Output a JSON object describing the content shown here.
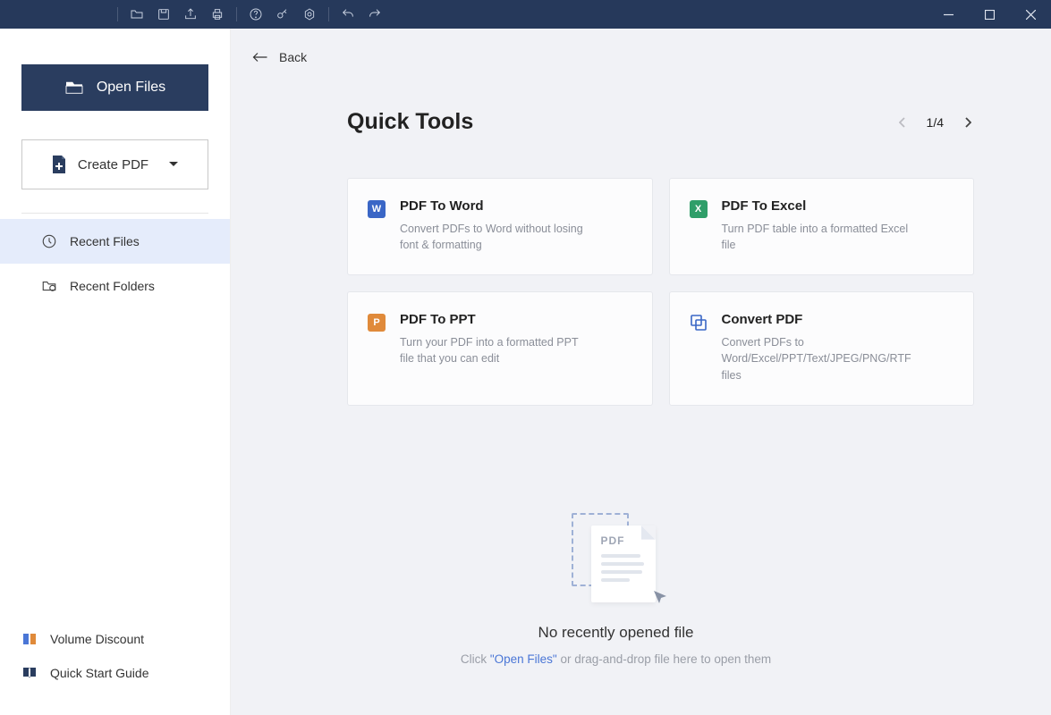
{
  "sidebar": {
    "open_files": "Open Files",
    "create_pdf": "Create PDF",
    "recent_files": "Recent Files",
    "recent_folders": "Recent Folders",
    "volume_discount": "Volume Discount",
    "quick_start_guide": "Quick Start Guide"
  },
  "main": {
    "back": "Back",
    "heading": "Quick Tools",
    "pager": "1/4",
    "tools": [
      {
        "title": "PDF To Word",
        "desc": "Convert PDFs to Word without losing font & formatting"
      },
      {
        "title": "PDF To Excel",
        "desc": "Turn PDF table into a formatted Excel file"
      },
      {
        "title": "PDF To PPT",
        "desc": "Turn your PDF into a formatted PPT file that you can edit"
      },
      {
        "title": "Convert PDF",
        "desc": "Convert PDFs to Word/Excel/PPT/Text/JPEG/PNG/RTF files"
      }
    ],
    "empty": {
      "pdf_badge": "PDF",
      "title": "No recently opened file",
      "sub_pre": "Click ",
      "sub_link": "\"Open Files\"",
      "sub_post": " or drag-and-drop file here to open them"
    }
  }
}
